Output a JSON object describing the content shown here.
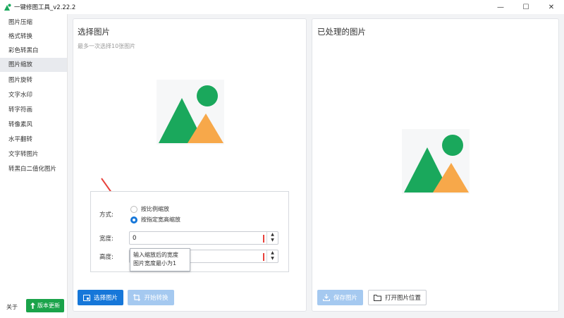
{
  "window": {
    "title": "一键修图工具_v2.22.2",
    "controls": {
      "minimize": "—",
      "maximize": "☐",
      "close": "✕"
    }
  },
  "sidebar": {
    "items": [
      {
        "label": "图片压缩"
      },
      {
        "label": "格式转换"
      },
      {
        "label": "彩色转黑白"
      },
      {
        "label": "图片缩放"
      },
      {
        "label": "图片旋转"
      },
      {
        "label": "文字水印"
      },
      {
        "label": "转字符画"
      },
      {
        "label": "转像素风"
      },
      {
        "label": "水平翻转"
      },
      {
        "label": "文字转图片"
      },
      {
        "label": "转黑白二值化图片"
      }
    ],
    "active_index": 3,
    "about_label": "关于",
    "update_label": "版本更新"
  },
  "left_panel": {
    "title": "选择图片",
    "subtitle": "最多一次选择10张图片",
    "settings": {
      "mode_label": "方式:",
      "options": [
        "按比例缩放",
        "按指定宽高缩放"
      ],
      "selected_option": 1,
      "width_label": "宽度:",
      "width_value": "0",
      "height_label": "高度:",
      "height_value": "",
      "tooltip_lines": [
        "输入缩放后的宽度",
        "图片宽度最小为1"
      ]
    },
    "select_button": "选择图片",
    "start_button": "开始转换"
  },
  "right_panel": {
    "title": "已处理的图片",
    "save_button": "保存图片",
    "open_location_button": "打开图片位置"
  },
  "colors": {
    "accent": "#1677d9",
    "update_green": "#1aa34a",
    "placeholder_green": "#1aa85c",
    "placeholder_orange": "#f7a84a",
    "annotation_red": "#e8413b"
  }
}
